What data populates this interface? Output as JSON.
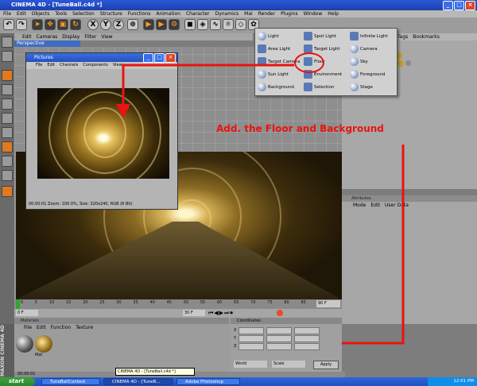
{
  "window": {
    "title": "CINEMA 4D - [TuneBall.c4d *]"
  },
  "menubar": [
    "File",
    "Edit",
    "Objects",
    "Tools",
    "Selection",
    "Structure",
    "Functions",
    "Animation",
    "Character",
    "Dynamics",
    "Mai",
    "Render",
    "Plugins",
    "Window",
    "Help"
  ],
  "toolbar": {
    "axes": [
      "X",
      "Y",
      "Z"
    ]
  },
  "viewport": {
    "menu": [
      "Edit",
      "Cameras",
      "Display",
      "Filter",
      "View"
    ],
    "label": "Perspective"
  },
  "pictures": {
    "title": "Pictures",
    "menu": [
      "File",
      "Edit",
      "Channels",
      "Components",
      "View"
    ],
    "status": "00:00:01 Zoom: 100.0%, Size: 320x240, RGB (8 Bit)"
  },
  "objects_manager": {
    "menu": [
      "Tags",
      "Bookmarks"
    ]
  },
  "dropdown": {
    "items": [
      "Light",
      "Spot Light",
      "Infinite Light",
      "Area Light",
      "Target Light",
      "Camera",
      "Target Camera",
      "Floor",
      "Sky",
      "Sun Light",
      "Environment",
      "Foreground",
      "Background",
      "Selection",
      "Stage"
    ]
  },
  "annotation": {
    "text": "Add. the Floor and Background",
    "color": "#e8140f"
  },
  "timeline": {
    "ticks": [
      "0",
      "5",
      "10",
      "15",
      "20",
      "25",
      "30",
      "35",
      "40",
      "45",
      "50",
      "55",
      "60",
      "65",
      "70",
      "75",
      "80",
      "85",
      "90"
    ],
    "frame_start": "0 F",
    "frame_end": "90 F",
    "current": "30 F"
  },
  "materials": {
    "header": "Materials",
    "menu": [
      "File",
      "Edit",
      "Function",
      "Texture"
    ],
    "mat_label": "Mat"
  },
  "coordinates": {
    "header": "Coordinates",
    "rows": [
      "X",
      "Y",
      "Z"
    ],
    "mode": "World",
    "scale": "Scale",
    "apply": "Apply"
  },
  "attributes": {
    "header": "Attributes",
    "menu": [
      "Mode",
      "Edit",
      "User Data"
    ]
  },
  "status": {
    "time": "00:00:01"
  },
  "branding": "MAXON CINEMA 4D",
  "tooltip": "CINEMA 4D - [TuneBall.c4d *]",
  "taskbar": {
    "start": "start",
    "tasks": [
      "TuneBallContest",
      "CINEMA 4D - [TuneB...",
      "Adobe Photoshop"
    ],
    "clock": "12:01 PM"
  }
}
